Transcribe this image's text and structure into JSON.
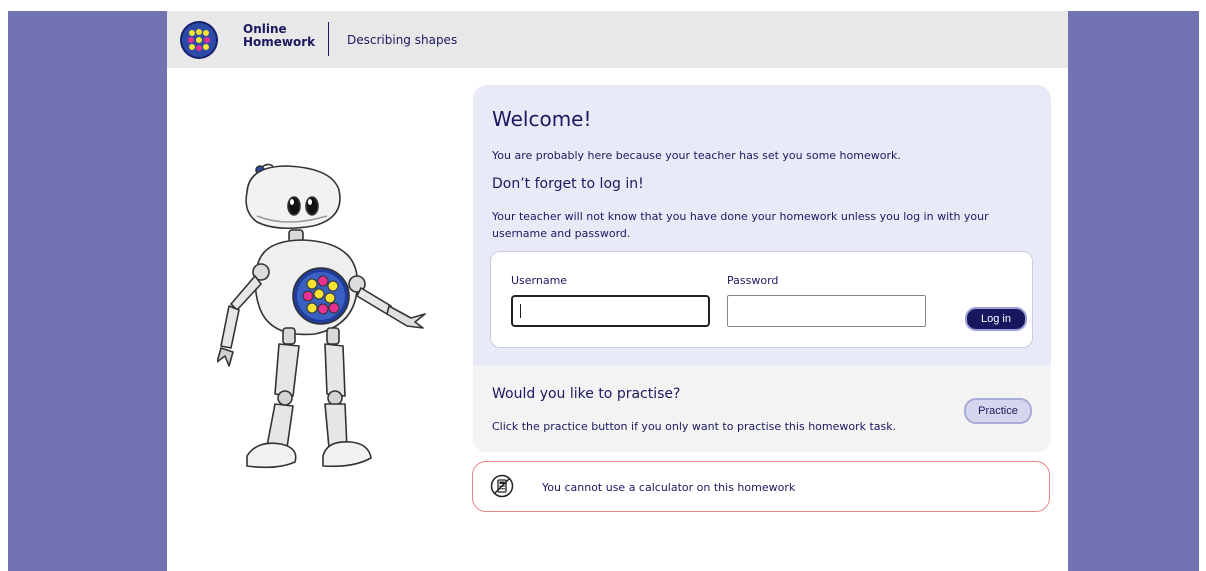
{
  "header": {
    "brand_line1": "Online",
    "brand_line2": "Homework",
    "breadcrumb": "Describing shapes",
    "logo_icon": "dotted-circle-logo"
  },
  "welcome": {
    "title": "Welcome!",
    "intro": "You are probably here because your teacher has set you some homework.",
    "subhead": "Don’t forget to log in!",
    "info": "Your teacher will not know that you have done your homework unless you log in with your username and password."
  },
  "login": {
    "username_label": "Username",
    "username_value": "",
    "password_label": "Password",
    "password_value": "",
    "button_label": "Log in"
  },
  "practice": {
    "title": "Would you like to practise?",
    "text": "Click the practice button if you only want to practise this homework task.",
    "button_label": "Practice"
  },
  "notice": {
    "text": "You cannot use a calculator on this homework",
    "icon": "no-calculator-icon"
  },
  "colors": {
    "side_panels": "#7173b2",
    "brand_navy": "#1b1a60",
    "card_bg": "#e9eaf7",
    "notice_border": "#e98585"
  }
}
